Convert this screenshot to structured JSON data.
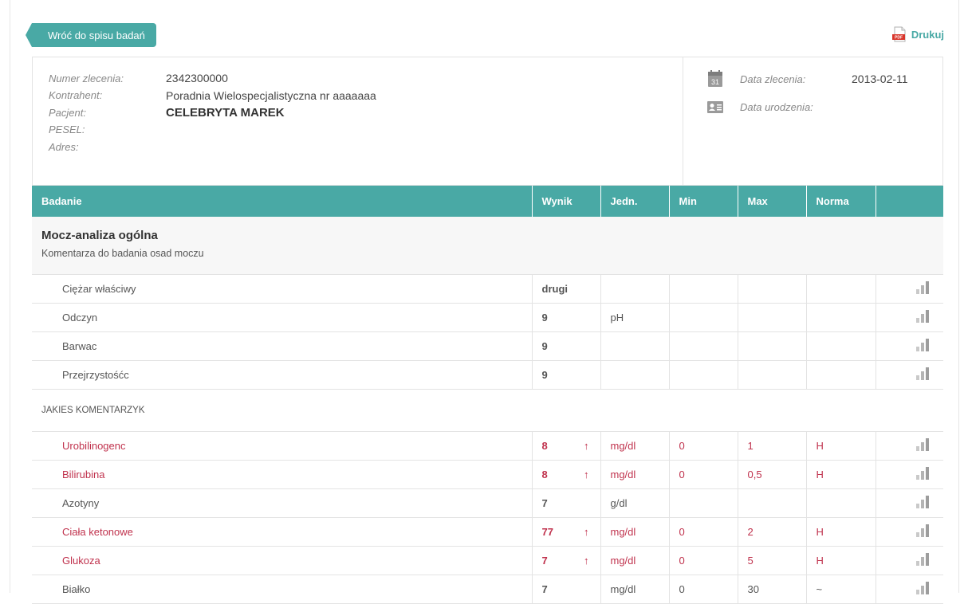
{
  "back_button": "Wróć do spisu badań",
  "print_label": "Drukuj",
  "info": {
    "order_number_label": "Numer zlecenia:",
    "order_number": "2342300000",
    "contractor_label": "Kontrahent:",
    "contractor": "Poradnia Wielospecjalistyczna nr aaaaaaa",
    "patient_label": "Pacjent:",
    "patient": "CELEBRYTA MAREK",
    "pesel_label": "PESEL:",
    "address_label": "Adres:",
    "order_date_label": "Data zlecenia:",
    "order_date": "2013-02-11",
    "birth_date_label": "Data urodzenia:",
    "calendar_day": "31"
  },
  "table": {
    "headers": [
      "Badanie",
      "Wynik",
      "Jedn.",
      "Min",
      "Max",
      "Norma",
      ""
    ],
    "section_title": "Mocz-analiza ogólna",
    "section_note": "Komentarza do badania osad moczu",
    "comment": "JAKIES KOMENTARZYK",
    "rows_a": [
      {
        "name": "Ciężar właściwy",
        "result": "drugi",
        "arrow": "",
        "unit": "",
        "min": "",
        "max": "",
        "norm": "",
        "high": false
      },
      {
        "name": "Odczyn",
        "result": "9",
        "arrow": "",
        "unit": "pH",
        "min": "",
        "max": "",
        "norm": "",
        "high": false
      },
      {
        "name": "Barwac",
        "result": "9",
        "arrow": "",
        "unit": "",
        "min": "",
        "max": "",
        "norm": "",
        "high": false
      },
      {
        "name": "Przejrzystośćc",
        "result": "9",
        "arrow": "",
        "unit": "",
        "min": "",
        "max": "",
        "norm": "",
        "high": false
      }
    ],
    "rows_b": [
      {
        "name": "Urobilinogenc",
        "result": "8",
        "arrow": "↑",
        "unit": "mg/dl",
        "min": "0",
        "max": "1",
        "norm": "H",
        "high": true
      },
      {
        "name": "Bilirubina",
        "result": "8",
        "arrow": "↑",
        "unit": "mg/dl",
        "min": "0",
        "max": "0,5",
        "norm": "H",
        "high": true
      },
      {
        "name": "Azotyny",
        "result": "7",
        "arrow": "",
        "unit": "g/dl",
        "min": "",
        "max": "",
        "norm": "",
        "high": false
      },
      {
        "name": "Ciała ketonowe",
        "result": "77",
        "arrow": "↑",
        "unit": "mg/dl",
        "min": "0",
        "max": "2",
        "norm": "H",
        "high": true
      },
      {
        "name": "Glukoza",
        "result": "7",
        "arrow": "↑",
        "unit": "mg/dl",
        "min": "0",
        "max": "5",
        "norm": "H",
        "high": true
      },
      {
        "name": "Białko",
        "result": "7",
        "arrow": "",
        "unit": "mg/dl",
        "min": "0",
        "max": "30",
        "norm": "~",
        "high": false
      }
    ]
  },
  "colors": {
    "accent": "#49a9a5",
    "high": "#c0324d"
  }
}
